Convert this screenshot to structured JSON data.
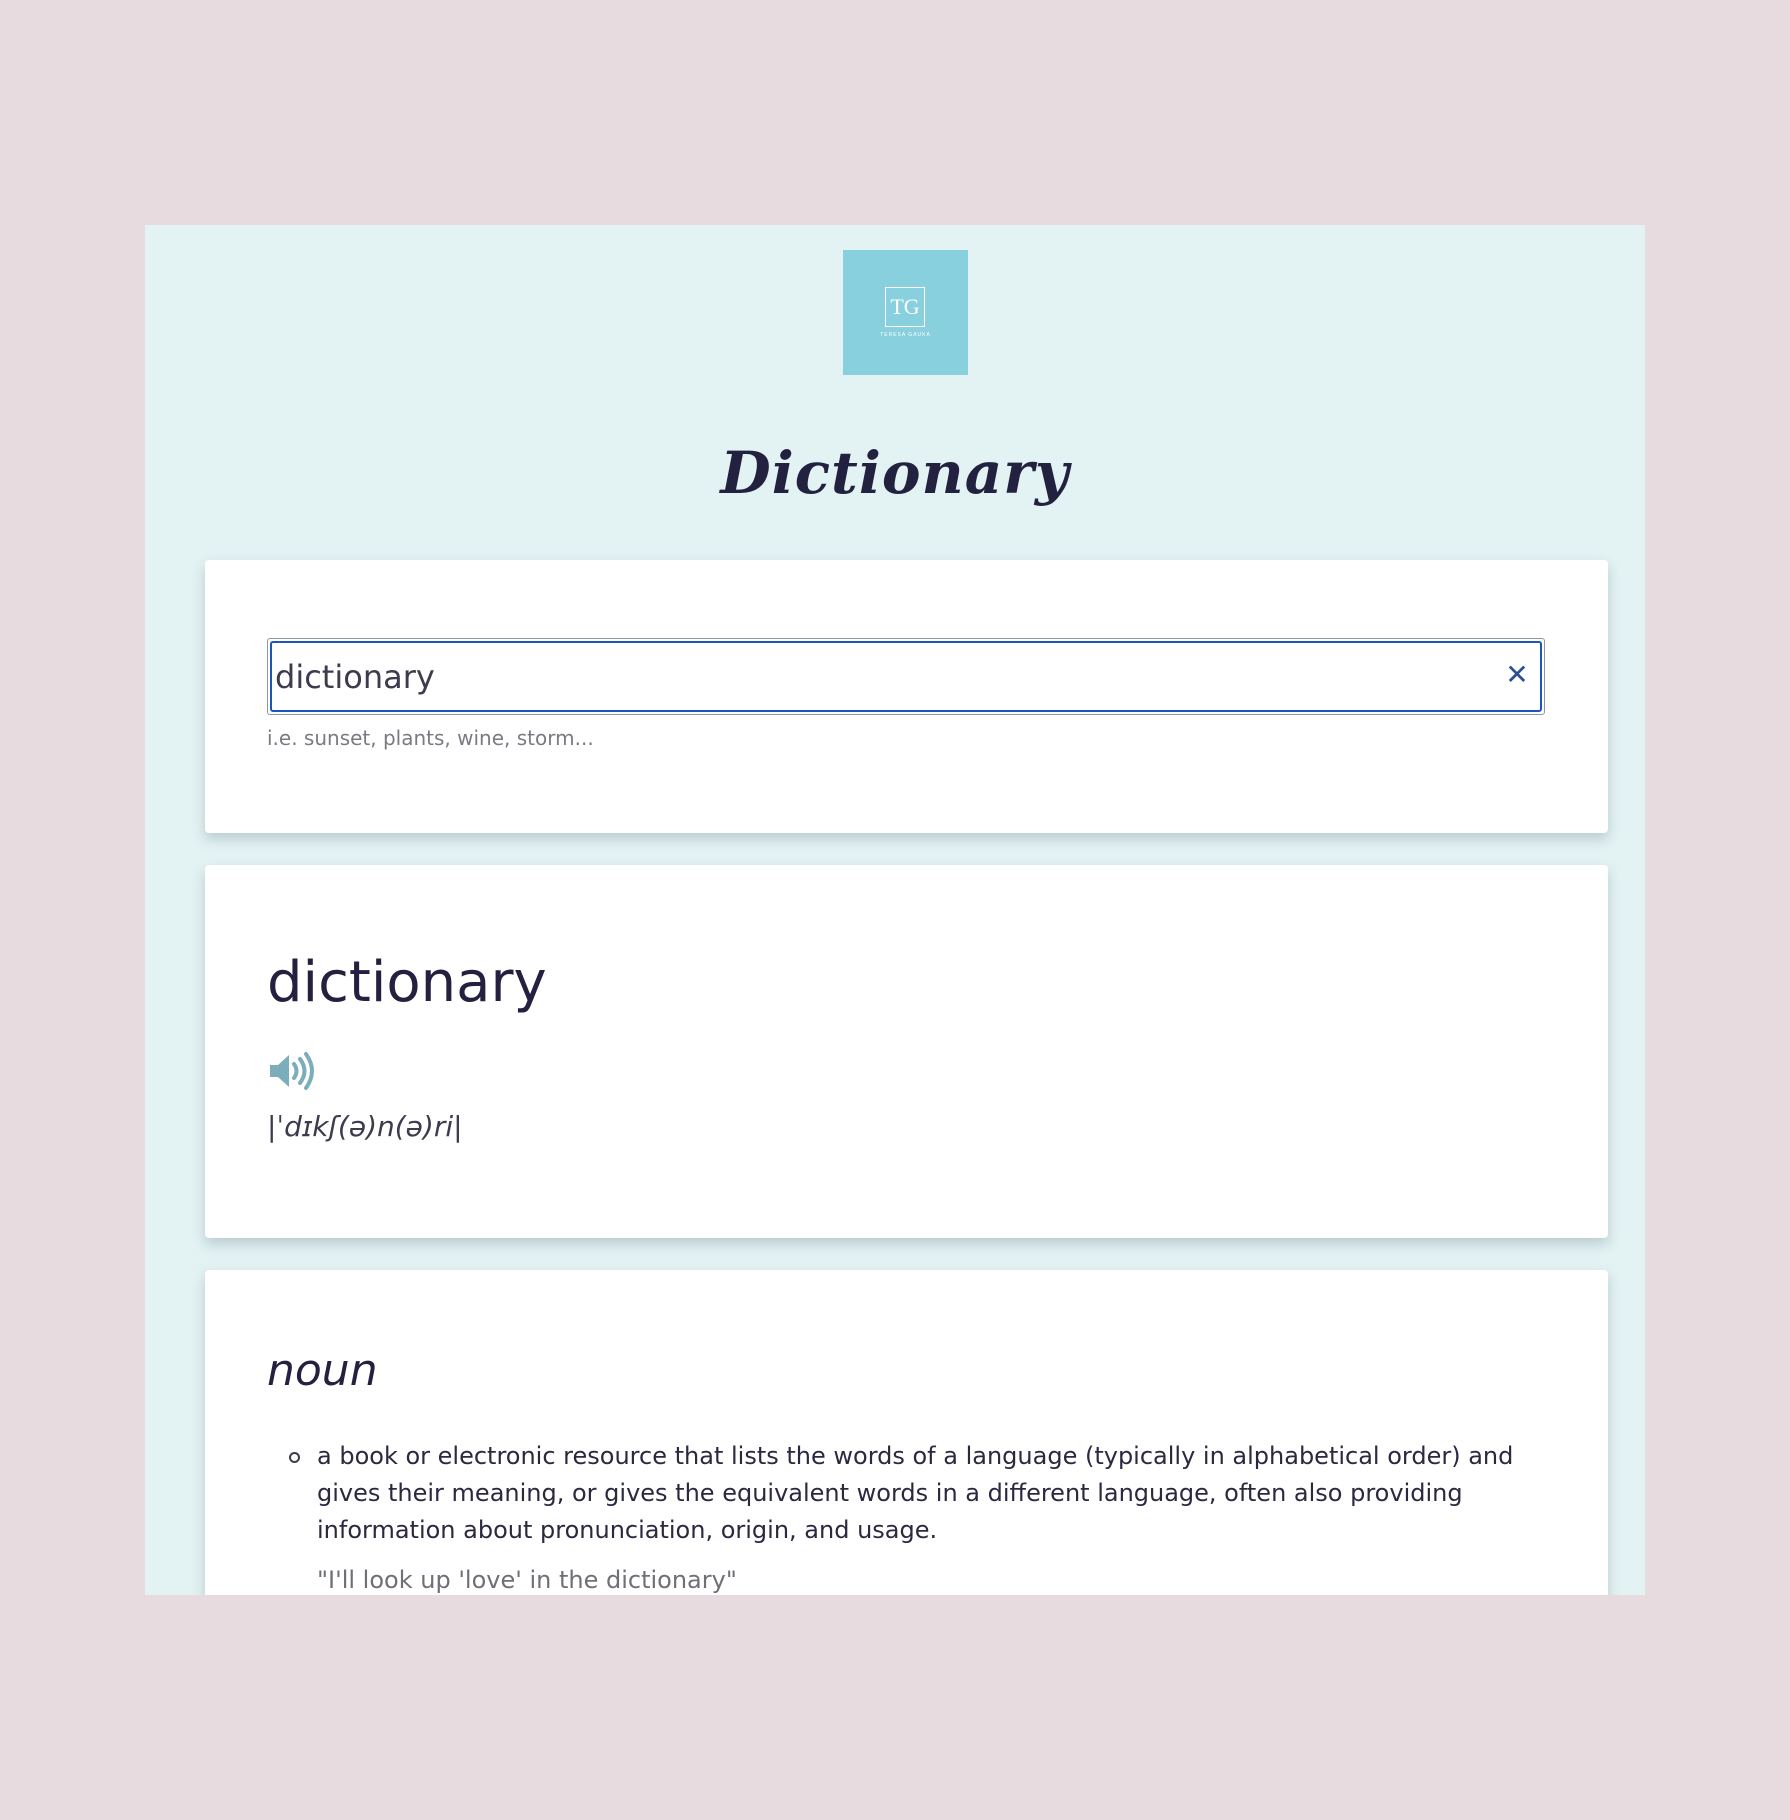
{
  "header": {
    "logo_text": "TG",
    "logo_subtext": "TERESA GAUKA",
    "title": "Dictionary"
  },
  "search": {
    "value": "dictionary",
    "hint": "i.e. sunset, plants, wine, storm...",
    "clear_icon": "close-icon",
    "clear_glyph": "✕"
  },
  "result": {
    "word": "dictionary",
    "audio_icon": "speaker-icon",
    "phonetic": "|ˈdɪkʃ(ə)n(ə)ri|"
  },
  "meanings": [
    {
      "part_of_speech": "noun",
      "definitions": [
        {
          "definition": "a book or electronic resource that lists the words of a language (typically in alphabetical order) and gives their meaning, or gives the equivalent words in a different language, often also providing information about pronunciation, origin, and usage.",
          "example": "\"I'll look up 'love' in the dictionary\""
        }
      ]
    }
  ],
  "colors": {
    "page_background": "#e8dbe0",
    "app_background": "#e3f2f3",
    "logo_background": "#88d0dd",
    "input_focus_border": "#1c56b8",
    "clear_icon": "#2c4f8f",
    "speaker_icon": "#7cadba",
    "text_primary": "#24203f"
  }
}
